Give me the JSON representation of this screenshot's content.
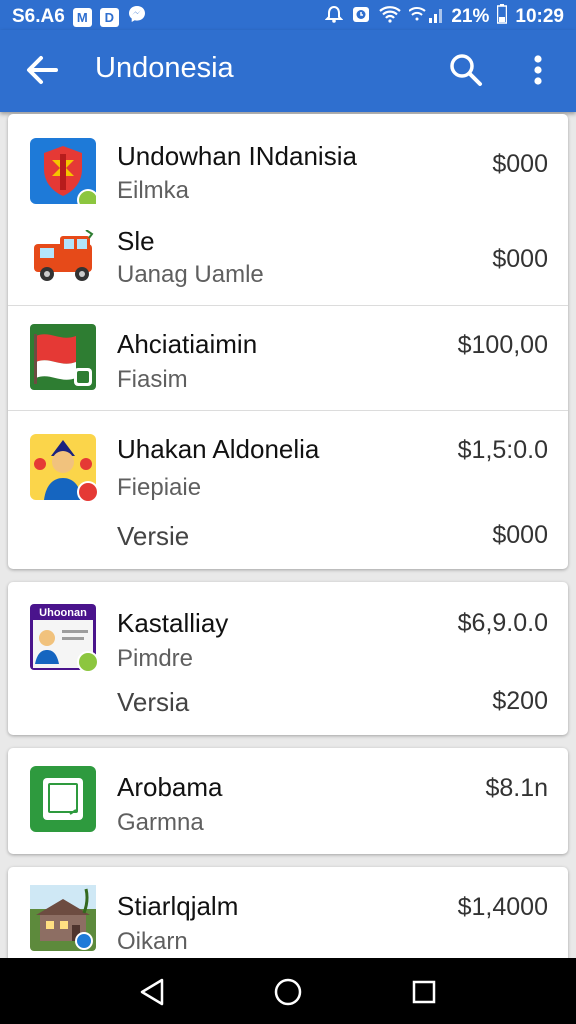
{
  "status_bar": {
    "carrier": "S6.A6",
    "box1": "M",
    "box2": "D",
    "battery": "21%",
    "time": "10:29"
  },
  "app_bar": {
    "title": "Undonesia"
  },
  "cards": [
    {
      "rows": [
        {
          "name": "Undowhan INdanisia",
          "sub": "Eilmka",
          "price": "$000",
          "icon": "shield-app-icon"
        },
        {
          "name": "Sle",
          "sub": "Uanag Uamle",
          "price": "$000",
          "icon": "truck-app-icon"
        },
        {
          "name": "Ahciatiaimin",
          "sub": "Fiasim",
          "price": "$100,00",
          "icon": "flag-app-icon"
        },
        {
          "name": "Uhakan Aldonelia",
          "sub": "Fiepiaie",
          "price": "$1,5:0.0",
          "icon": "character-app-icon"
        },
        {
          "name": "Versie",
          "price": "$000"
        }
      ]
    },
    {
      "rows": [
        {
          "name": "Kastalliay",
          "sub": "Pimdre",
          "price": "$6,9.0.0",
          "icon": "book-app-icon",
          "icon_text": "Uhoonan"
        },
        {
          "name": "Versia",
          "price": "$200"
        }
      ]
    },
    {
      "rows": [
        {
          "name": "Arobama",
          "sub": "Garmna",
          "price": "$8.1n",
          "icon": "tablet-app-icon"
        }
      ]
    },
    {
      "rows": [
        {
          "name": "Stiarlqjalm",
          "sub": "Oikarn",
          "price": "$1,4000",
          "icon": "house-app-icon"
        }
      ]
    }
  ],
  "colors": {
    "primary": "#2f6fcf",
    "card": "#ffffff",
    "background": "#e9e9e9",
    "navbar": "#000000"
  }
}
